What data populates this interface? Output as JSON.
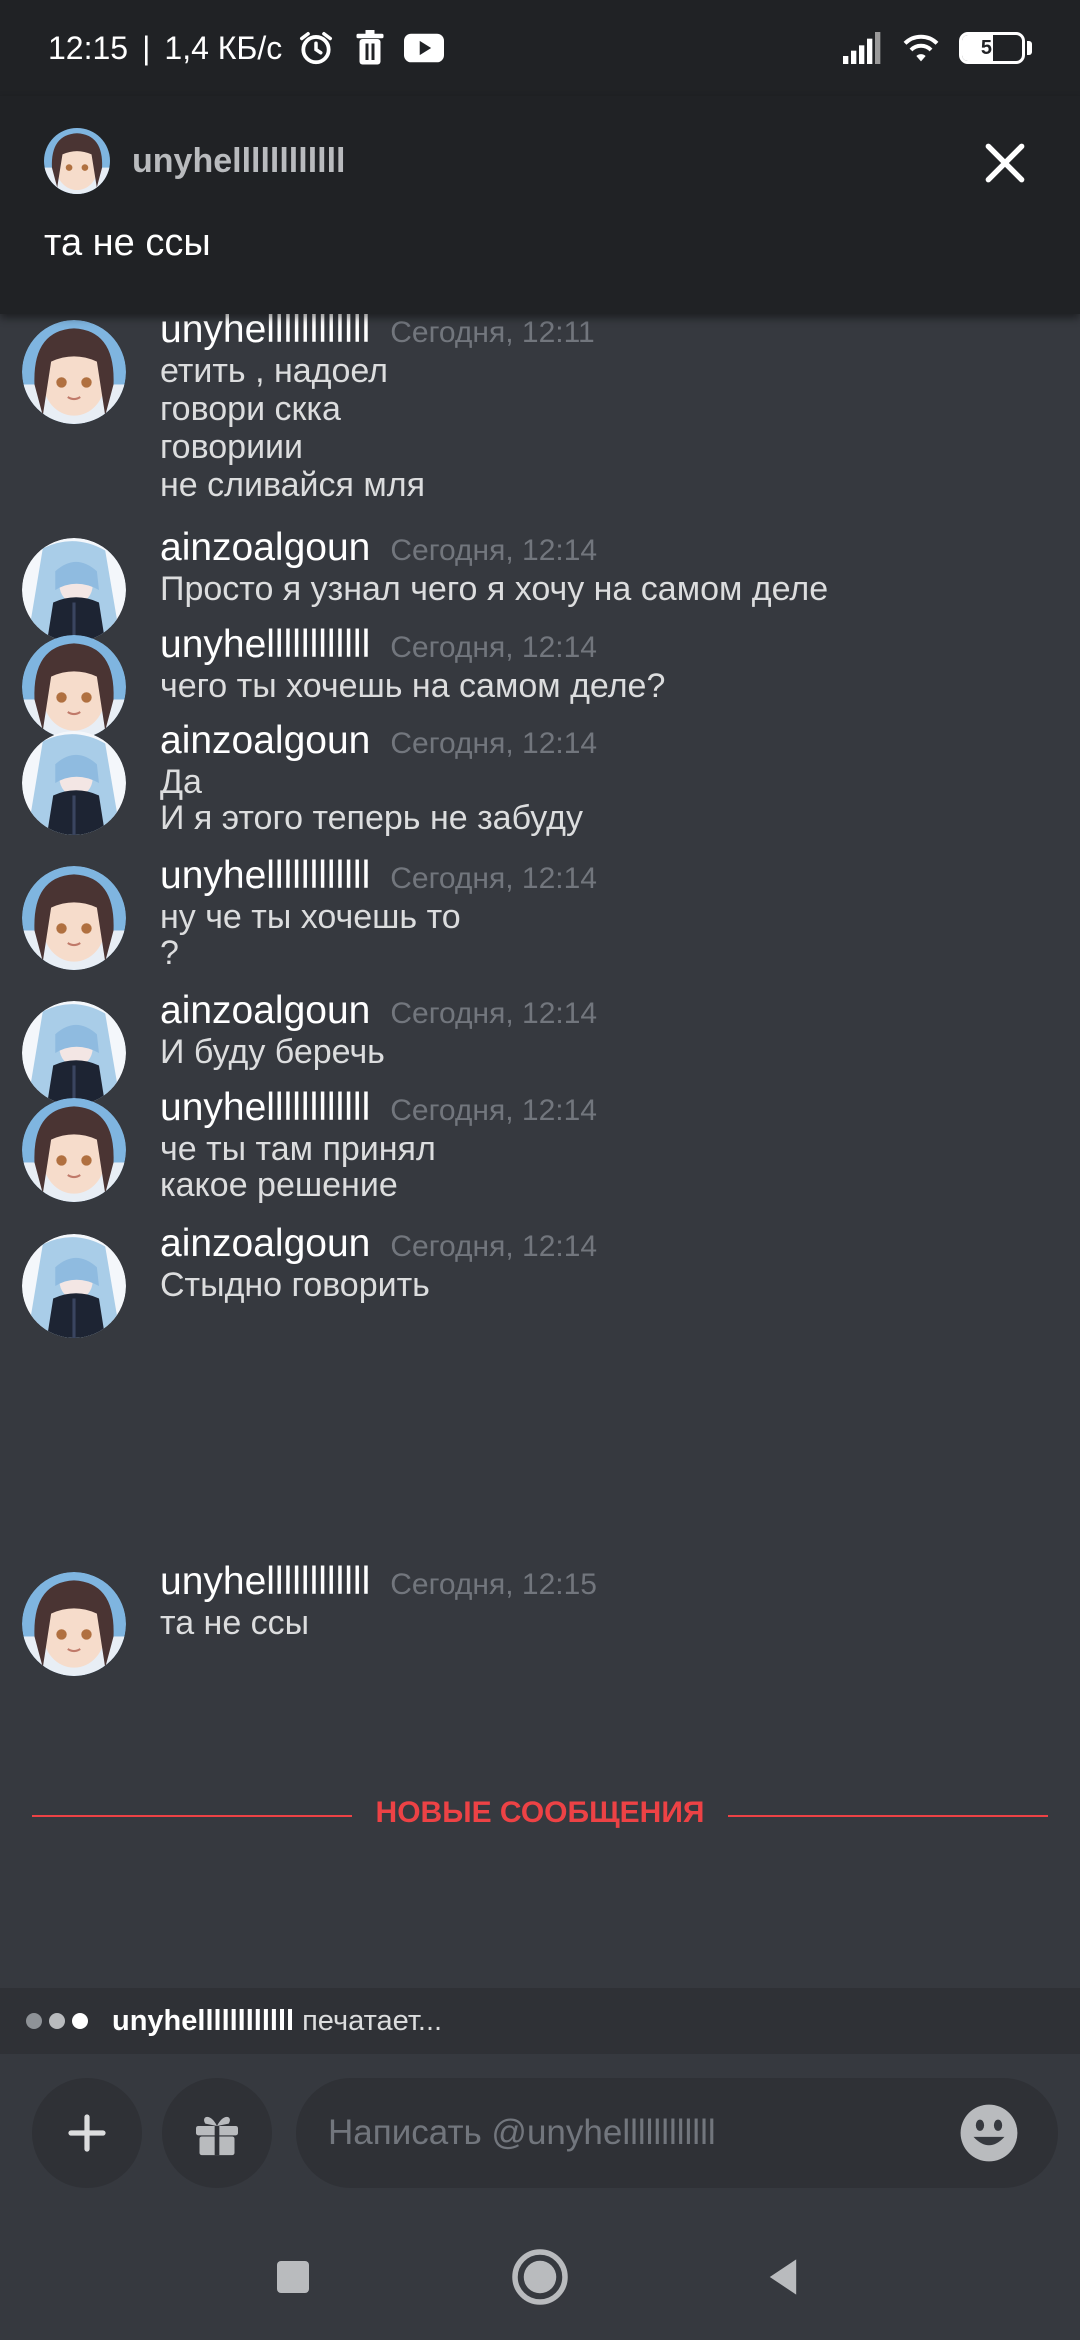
{
  "status_bar": {
    "time": "12:15",
    "separator": "|",
    "network_speed": "1,4 КБ/с",
    "battery_percent": 51,
    "battery_label": "51"
  },
  "banner": {
    "username": "unyhellllllllllll",
    "message": "та не ссы"
  },
  "messages": [
    {
      "author": "unyhellllllllllll",
      "avatar": "avatar-brown-hair",
      "timestamp": "Сегодня, 12:11",
      "lines": [
        "етить   , надоел",
        "говори скка",
        "говориии",
        "не сливайся мля"
      ]
    },
    {
      "author": "ainzoalgoun",
      "avatar": "avatar-blue-hair",
      "timestamp": "Сегодня, 12:14",
      "lines": [
        "Просто я узнал чего я хочу на самом деле"
      ]
    },
    {
      "author": "unyhellllllllllll",
      "avatar": "avatar-brown-hair",
      "timestamp": "Сегодня, 12:14",
      "lines": [
        "чего ты хочешь на самом деле?"
      ]
    },
    {
      "author": "ainzoalgoun",
      "avatar": "avatar-blue-hair",
      "timestamp": "Сегодня, 12:14",
      "lines": [
        "Да",
        "И я этого теперь не забуду"
      ]
    },
    {
      "author": "unyhellllllllllll",
      "avatar": "avatar-brown-hair",
      "timestamp": "Сегодня, 12:14",
      "lines": [
        "ну че ты хочешь то",
        "?"
      ]
    },
    {
      "author": "ainzoalgoun",
      "avatar": "avatar-blue-hair",
      "timestamp": "Сегодня, 12:14",
      "lines": [
        "И буду беречь"
      ]
    },
    {
      "author": "unyhellllllllllll",
      "avatar": "avatar-brown-hair",
      "timestamp": "Сегодня, 12:14",
      "lines": [
        "че ты там принял",
        "какое решение"
      ]
    },
    {
      "author": "ainzoalgoun",
      "avatar": "avatar-blue-hair",
      "timestamp": "Сегодня, 12:14",
      "lines": [
        "Стыдно говорить"
      ]
    },
    {
      "author": "unyhellllllllllll",
      "avatar": "avatar-brown-hair",
      "timestamp": "Сегодня, 12:15",
      "lines": [
        "та не ссы"
      ]
    }
  ],
  "new_messages_divider": "НОВЫЕ СООБЩЕНИЯ",
  "typing": {
    "user": "unyhellllllllllll",
    "suffix": "печатает..."
  },
  "composer": {
    "placeholder": "Написать @unyhellllllllllll",
    "value": ""
  },
  "colors": {
    "background": "#36393f",
    "header": "#202225",
    "accent_red": "#ed4245",
    "muted": "#72767d"
  }
}
